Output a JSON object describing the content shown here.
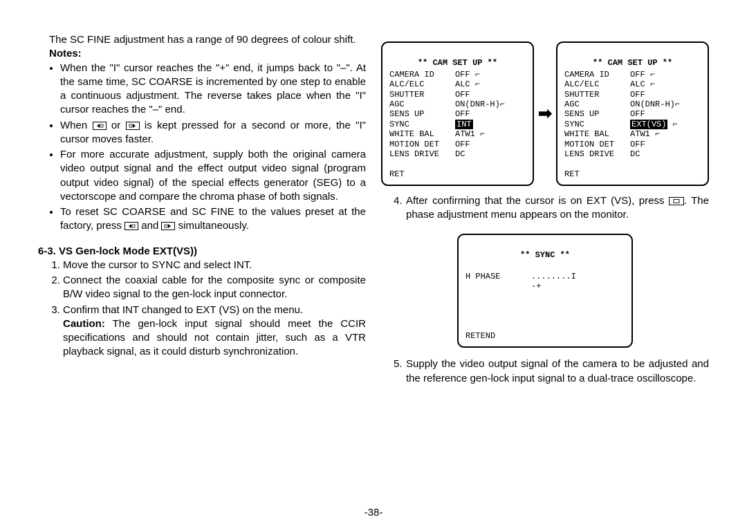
{
  "left": {
    "intro": "The SC FINE adjustment has a range of 90 degrees of colour shift.",
    "notes_label": "Notes:",
    "bullets": [
      "When the \"I\" cursor reaches the \"+\" end, it jumps back to \"–\". At the same time, SC COARSE is incremented by one step to enable a continuous adjustment. The reverse takes place when the \"I\" cursor reaches the \"–\" end.",
      {
        "pre": "When ",
        "mid": " or ",
        "post": " is kept pressed for a second or more, the \"I\" cursor moves faster."
      },
      "For more accurate adjustment, supply both the original camera video output signal and the effect output video signal (program output video signal) of the special effects generator (SEG) to a vectorscope and compare the chroma phase of both signals.",
      {
        "pre": "To reset SC COARSE and SC FINE to the values preset at the factory, press ",
        "mid": " and ",
        "post": " simultaneously."
      }
    ],
    "section_title": "6-3. VS Gen-lock Mode EXT(VS))",
    "steps": [
      "Move the cursor to SYNC and select INT.",
      "Connect the coaxial cable for the composite sync or composite B/W video signal to the gen-lock input connector.",
      "Confirm that INT changed to EXT (VS) on the menu.",
      {
        "caution_label": "Caution:",
        "caution_text": " The gen-lock input signal should meet the CCIR specifications and should not contain jitter, such as a VTR playback signal, as it could disturb synchronization."
      }
    ]
  },
  "right": {
    "menus": {
      "title": "** CAM SET UP **",
      "rows": [
        {
          "k": "CAMERA ID",
          "v": "OFF ⌐"
        },
        {
          "k": "ALC/ELC",
          "v": "ALC ⌐"
        },
        {
          "k": "SHUTTER",
          "v": "OFF"
        },
        {
          "k": "AGC",
          "v": "ON(DNR-H)⌐"
        },
        {
          "k": "SENS UP",
          "v": "OFF"
        },
        {
          "k": "SYNC",
          "v_left_sel": "INT",
          "v_right_sel": "EXT(VS)",
          "v_right_tail": " ⌐"
        },
        {
          "k": "WHITE BAL",
          "v": "ATW1 ⌐"
        },
        {
          "k": "MOTION DET",
          "v": "OFF"
        },
        {
          "k": "LENS DRIVE",
          "v": "DC"
        }
      ],
      "ret": "RET"
    },
    "step4": {
      "num": "4.",
      "pre": "After confirming that the cursor is on EXT (VS), press ",
      "post": ". The phase adjustment menu appears on the monitor."
    },
    "sync_menu": {
      "title": "** SYNC **",
      "row_label": "H PHASE",
      "row_val": "........I",
      "minus": "-",
      "plus": "+",
      "ret": "RET",
      "end": "END"
    },
    "step5": {
      "num": "5.",
      "text": "Supply the video output signal of the camera to be adjusted and the reference gen-lock input signal to a dual-trace oscilloscope."
    }
  },
  "page_number": "-38-"
}
